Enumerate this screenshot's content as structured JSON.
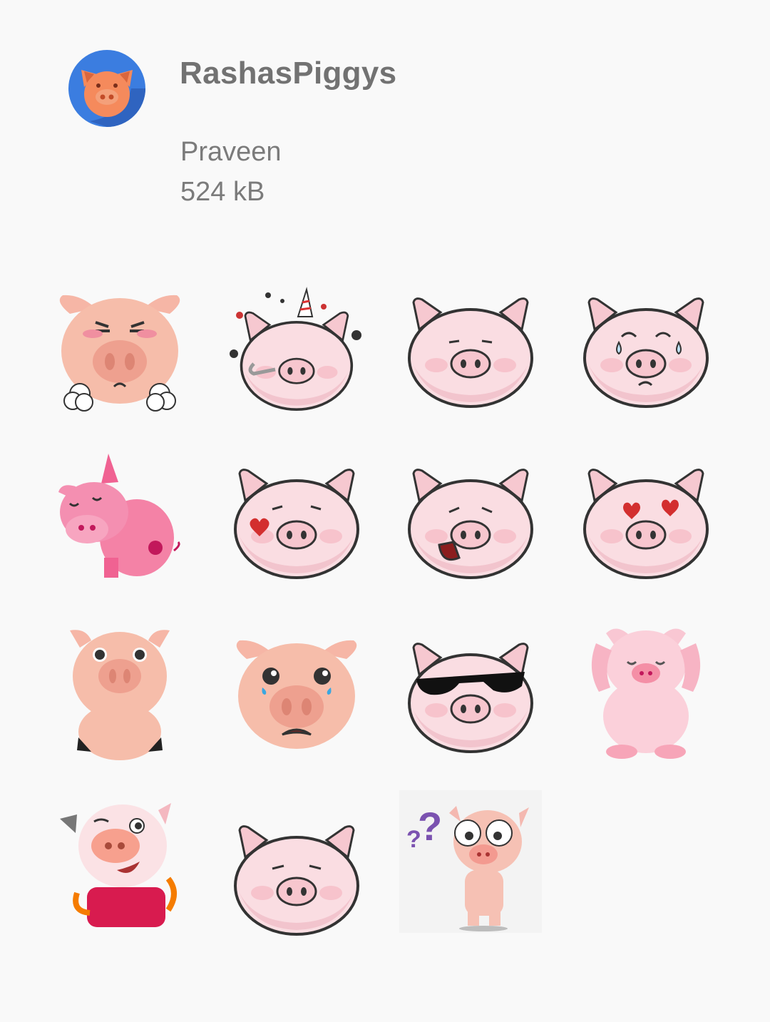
{
  "pack": {
    "title": "RashasPiggys",
    "publisher": "Praveen",
    "size": "524 kB",
    "tray_icon": "pig-face-icon"
  },
  "colors": {
    "background": "#f9f9f9",
    "tray_circle": "#3b7de0",
    "pig_orange": "#f58a5c",
    "pig_pink": "#f9dce0",
    "text_gray": "#727272"
  },
  "stickers": [
    {
      "icon": "angry-pig-sticker"
    },
    {
      "icon": "party-pig-sticker"
    },
    {
      "icon": "smirk-pig-sticker"
    },
    {
      "icon": "crying-pig-sticker"
    },
    {
      "icon": "sleepy-pink-pig-sticker"
    },
    {
      "icon": "kiss-pig-sticker"
    },
    {
      "icon": "laughing-pig-sticker"
    },
    {
      "icon": "heart-eyes-pig-sticker"
    },
    {
      "icon": "sitting-pig-sticker"
    },
    {
      "icon": "sad-pig-sticker"
    },
    {
      "icon": "sunglasses-pig-sticker"
    },
    {
      "icon": "facepalm-pig-sticker"
    },
    {
      "icon": "winking-pig-sticker"
    },
    {
      "icon": "smug-pig-sticker"
    },
    {
      "icon": "confused-pig-sticker"
    }
  ]
}
